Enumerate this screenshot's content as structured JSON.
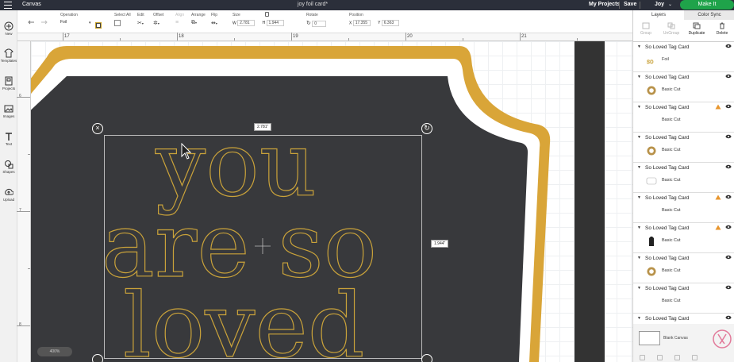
{
  "app": {
    "name": "Canvas",
    "project_title": "joy foil card*",
    "my_projects": "My Projects",
    "save": "Save",
    "user": "Joy",
    "make_it": "Make It"
  },
  "toolbar": {
    "operation_label": "Operation",
    "operation_value": "Foil",
    "select_all_label": "Select All",
    "edit_label": "Edit",
    "offset_label": "Offset",
    "align_label": "Align",
    "arrange_label": "Arrange",
    "flip_label": "Flip",
    "size_label": "Size",
    "width_prefix": "W",
    "width_value": "2.781",
    "height_prefix": "H",
    "height_value": "1.944",
    "rotate_label": "Rotate",
    "rotate_value": "0",
    "position_label": "Position",
    "x_prefix": "X",
    "x_value": "17.355",
    "y_prefix": "Y",
    "y_value": "6.363"
  },
  "leftnav": {
    "items": [
      {
        "label": "New",
        "icon": "plus-icon"
      },
      {
        "label": "Templates",
        "icon": "shirt-icon"
      },
      {
        "label": "Projects",
        "icon": "projects-icon"
      },
      {
        "label": "Images",
        "icon": "image-icon"
      },
      {
        "label": "Text",
        "icon": "text-icon"
      },
      {
        "label": "Shapes",
        "icon": "shapes-icon"
      },
      {
        "label": "Upload",
        "icon": "upload-icon"
      }
    ]
  },
  "ruler": {
    "top_numbers": [
      "17",
      "18",
      "19",
      "20",
      "21"
    ],
    "left_numbers": [
      "6",
      "7",
      "8"
    ]
  },
  "canvas": {
    "text_lines": [
      "you",
      "are so",
      "loved"
    ],
    "width_badge": "2.781\"",
    "height_badge": "1.944\"",
    "zoom": "400%",
    "colors": {
      "gold": "#d9a538",
      "board": "#38393c",
      "foil_outline": "#c9a23a"
    }
  },
  "rpanel": {
    "tabs": [
      "Layers",
      "Color Sync"
    ],
    "actions": [
      {
        "label": "Group",
        "enabled": false
      },
      {
        "label": "UnGroup",
        "enabled": false
      },
      {
        "label": "Duplicate",
        "enabled": true
      },
      {
        "label": "Delete",
        "enabled": true
      }
    ],
    "layers": [
      {
        "name": "So Loved Tag Card",
        "sub": "Foil",
        "thumb": "foil",
        "warn": false
      },
      {
        "name": "So Loved Tag Card",
        "sub": "Basic Cut",
        "thumb": "ring-gold",
        "warn": false
      },
      {
        "name": "So Loved Tag Card",
        "sub": "Basic Cut",
        "thumb": "none",
        "warn": true
      },
      {
        "name": "So Loved Tag Card",
        "sub": "Basic Cut",
        "thumb": "ring-gold",
        "warn": false
      },
      {
        "name": "So Loved Tag Card",
        "sub": "Basic Cut",
        "thumb": "white-rect",
        "warn": false
      },
      {
        "name": "So Loved Tag Card",
        "sub": "Basic Cut",
        "thumb": "none",
        "warn": true
      },
      {
        "name": "So Loved Tag Card",
        "sub": "Basic Cut",
        "thumb": "black-tag",
        "warn": true
      },
      {
        "name": "So Loved Tag Card",
        "sub": "Basic Cut",
        "thumb": "ring-gold",
        "warn": false
      },
      {
        "name": "So Loved Tag Card",
        "sub": "Basic Cut",
        "thumb": "none",
        "warn": false
      },
      {
        "name": "So Loved Tag Card",
        "sub": "",
        "thumb": "none",
        "warn": false
      }
    ],
    "blank_canvas": "Blank Canvas"
  }
}
